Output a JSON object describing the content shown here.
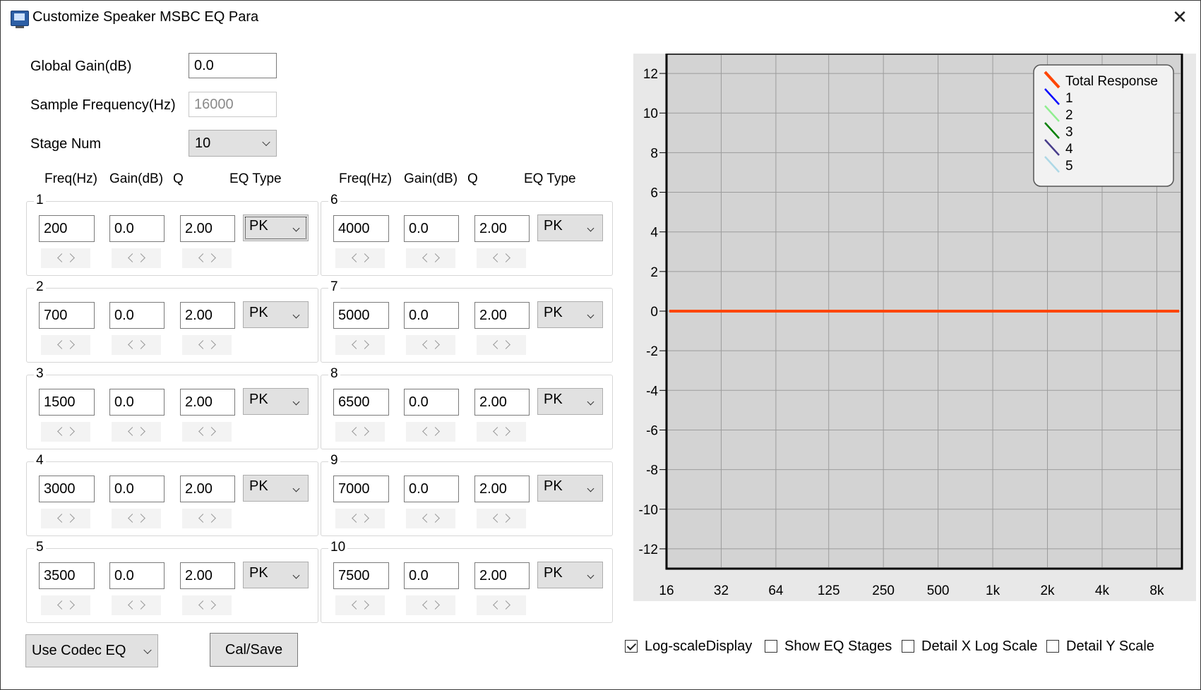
{
  "window": {
    "title": "Customize Speaker MSBC EQ Para",
    "close_label": "✕"
  },
  "global": {
    "gain_label": "Global Gain(dB)",
    "gain_value": "0.0",
    "sample_label": "Sample Frequency(Hz)",
    "sample_value": "16000",
    "stage_label": "Stage Num",
    "stage_value": "10"
  },
  "columns": [
    "Freq(Hz)",
    "Gain(dB)",
    "Q",
    "EQ Type"
  ],
  "stages": [
    {
      "num": "1",
      "freq": "200",
      "gain": "0.0",
      "q": "2.00",
      "type": "PK"
    },
    {
      "num": "2",
      "freq": "700",
      "gain": "0.0",
      "q": "2.00",
      "type": "PK"
    },
    {
      "num": "3",
      "freq": "1500",
      "gain": "0.0",
      "q": "2.00",
      "type": "PK"
    },
    {
      "num": "4",
      "freq": "3000",
      "gain": "0.0",
      "q": "2.00",
      "type": "PK"
    },
    {
      "num": "5",
      "freq": "3500",
      "gain": "0.0",
      "q": "2.00",
      "type": "PK"
    },
    {
      "num": "6",
      "freq": "4000",
      "gain": "0.0",
      "q": "2.00",
      "type": "PK"
    },
    {
      "num": "7",
      "freq": "5000",
      "gain": "0.0",
      "q": "2.00",
      "type": "PK"
    },
    {
      "num": "8",
      "freq": "6500",
      "gain": "0.0",
      "q": "2.00",
      "type": "PK"
    },
    {
      "num": "9",
      "freq": "7000",
      "gain": "0.0",
      "q": "2.00",
      "type": "PK"
    },
    {
      "num": "10",
      "freq": "7500",
      "gain": "0.0",
      "q": "2.00",
      "type": "PK"
    }
  ],
  "bottom": {
    "codec_select": "Use Codec EQ",
    "cal_button": "Cal/Save"
  },
  "options": [
    {
      "label": "Log-scaleDisplay",
      "checked": true
    },
    {
      "label": "Show EQ Stages",
      "checked": false
    },
    {
      "label": "Detail X Log Scale",
      "checked": false
    },
    {
      "label": "Detail Y Scale",
      "checked": false
    }
  ],
  "chart_data": {
    "type": "line",
    "x_log_scale": true,
    "x_ticks": [
      "16",
      "32",
      "64",
      "125",
      "250",
      "500",
      "1k",
      "2k",
      "4k",
      "8k"
    ],
    "x_tick_values": [
      16,
      32,
      64,
      125,
      250,
      500,
      1000,
      2000,
      4000,
      8000
    ],
    "y_ticks": [
      "12",
      "10",
      "8",
      "6",
      "4",
      "2",
      "0",
      "-2",
      "-4",
      "-6",
      "-8",
      "-10",
      "-12"
    ],
    "ylim": [
      -13,
      13
    ],
    "xlim": [
      16,
      11000
    ],
    "grid": true,
    "legend_position": "top-right",
    "series": [
      {
        "name": "Total Response",
        "color": "#ff4500",
        "x": [
          16,
          11000
        ],
        "y": [
          0,
          0
        ]
      },
      {
        "name": "1",
        "color": "#0000ff"
      },
      {
        "name": "2",
        "color": "#90ee90"
      },
      {
        "name": "3",
        "color": "#008000"
      },
      {
        "name": "4",
        "color": "#483d8b"
      },
      {
        "name": "5",
        "color": "#add8e6"
      }
    ],
    "plot_bg": "#d3d3d3"
  }
}
